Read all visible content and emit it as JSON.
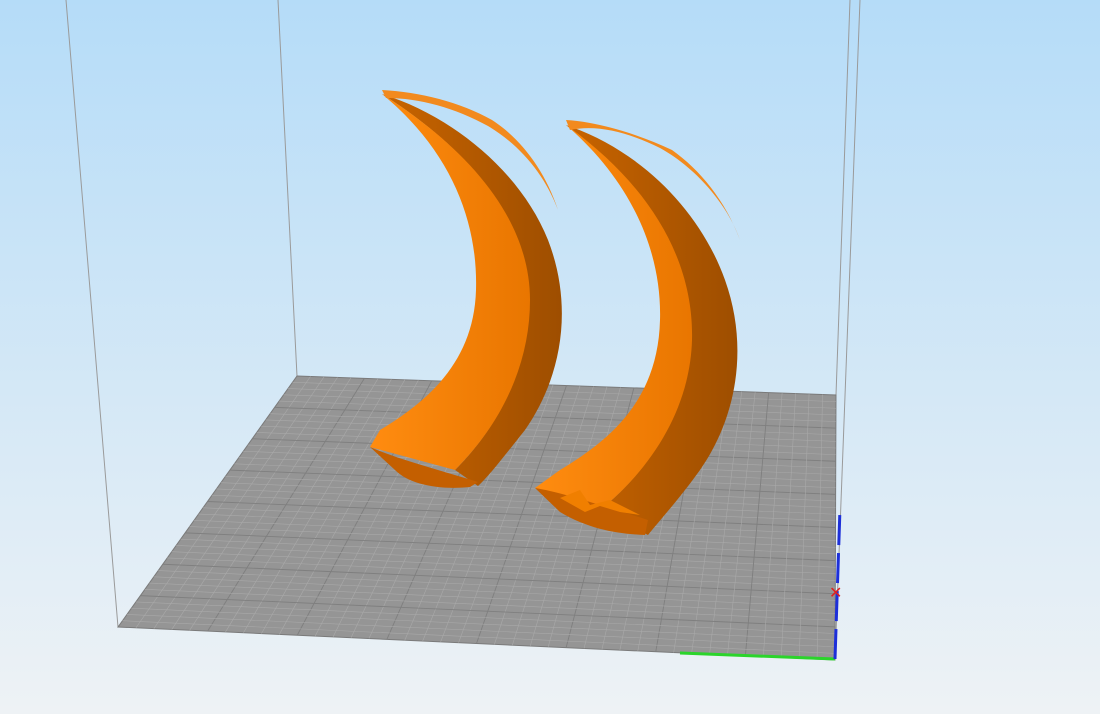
{
  "viewport": {
    "background_top": "#b5dcf8",
    "background_bottom": "#eef2f5"
  },
  "build_plate": {
    "color": "#959595",
    "grid_color": "#a9a9a9",
    "grid_major_color": "#7f7f7f"
  },
  "build_volume": {
    "edge_color": "#9a9a9a"
  },
  "models": [
    {
      "name": "horn-left",
      "color": "#f07f00",
      "shade_color": "#b35a00"
    },
    {
      "name": "horn-right",
      "color": "#f07f00",
      "shade_color": "#b35a00"
    }
  ],
  "axes": {
    "x_color": "#2bd42b",
    "y_color": "#1d2fd9",
    "origin_marker_color": "#e02020"
  }
}
